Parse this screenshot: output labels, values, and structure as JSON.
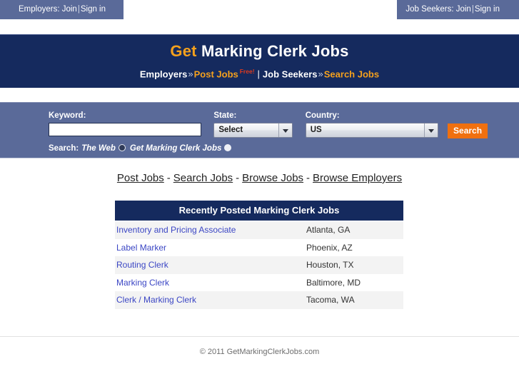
{
  "topbar": {
    "employers": {
      "prefix": "Employers:",
      "join": "Join",
      "sep": "|",
      "signin": "Sign in"
    },
    "jobseekers": {
      "prefix": "Job Seekers:",
      "join": "Join",
      "sep": "|",
      "signin": "Sign in"
    }
  },
  "banner": {
    "title_accent": "Get",
    "title_rest": " Marking Clerk Jobs",
    "sub": {
      "employers": "Employers",
      "chev1": "»",
      "post_jobs": "Post Jobs",
      "free": "Free!",
      "pipe": "|",
      "job_seekers": "Job Seekers",
      "chev2": "»",
      "search_jobs": "Search Jobs"
    }
  },
  "search": {
    "keyword_label": "Keyword:",
    "keyword_value": "",
    "keyword_placeholder": "",
    "state_label": "State:",
    "state_value": "Select",
    "country_label": "Country:",
    "country_value": "US",
    "search_button": "Search",
    "scope_label": "Search:",
    "scope_option_web": "The Web",
    "scope_option_site": "Get Marking Clerk Jobs",
    "scope_selected": "site"
  },
  "navlinks": {
    "post_jobs": "Post Jobs",
    "search_jobs": "Search Jobs",
    "browse_jobs": "Browse Jobs",
    "browse_employers": "Browse Employers",
    "dash": "-"
  },
  "jobs": {
    "heading": "Recently Posted Marking Clerk Jobs",
    "rows": [
      {
        "title": "Inventory and Pricing Associate",
        "location": "Atlanta, GA"
      },
      {
        "title": "Label Marker",
        "location": "Phoenix, AZ"
      },
      {
        "title": "Routing Clerk",
        "location": "Houston, TX"
      },
      {
        "title": "Marking Clerk",
        "location": "Baltimore, MD"
      },
      {
        "title": "Clerk / Marking Clerk",
        "location": "Tacoma, WA"
      }
    ]
  },
  "footer": {
    "copyright": "© 2011 GetMarkingClerkJobs.com"
  },
  "colors": {
    "navy": "#152a5e",
    "slate": "#5a6a99",
    "orange": "#f0700f",
    "title_accent": "#f5a11d",
    "link_blue": "#3b46c4",
    "free_red": "#e03a1e"
  }
}
